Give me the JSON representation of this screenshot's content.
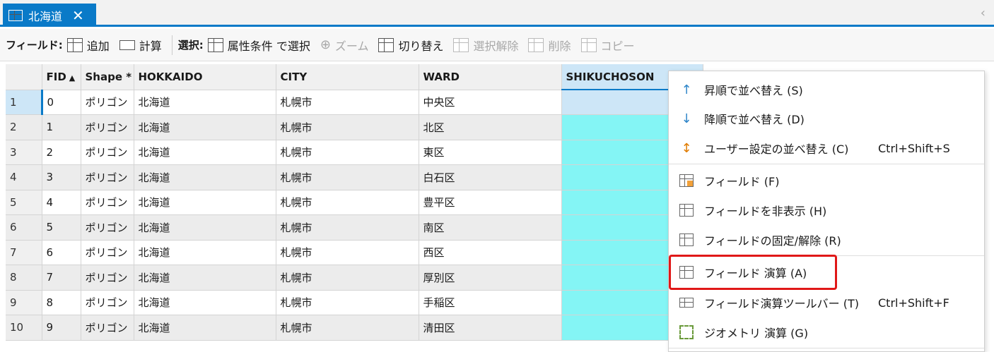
{
  "tab": {
    "title": "北海道",
    "close": "✕"
  },
  "toolbar": {
    "field_label": "フィールド:",
    "add": "追加",
    "calc": "計算",
    "select_label": "選択:",
    "select_by_attr": "属性条件 で選択",
    "zoom": "ズーム",
    "switch": "切り替え",
    "clear": "選択解除",
    "delete": "削除",
    "copy": "コピー"
  },
  "table": {
    "headers": [
      "FID",
      "Shape *",
      "HOKKAIDO",
      "CITY",
      "WARD",
      "SHIKUCHOSON"
    ],
    "rows": [
      {
        "num": "1",
        "fid": "0",
        "shape": "ポリゴン",
        "hokkaido": "北海道",
        "city": "札幌市",
        "ward": "中央区"
      },
      {
        "num": "2",
        "fid": "1",
        "shape": "ポリゴン",
        "hokkaido": "北海道",
        "city": "札幌市",
        "ward": "北区"
      },
      {
        "num": "3",
        "fid": "2",
        "shape": "ポリゴン",
        "hokkaido": "北海道",
        "city": "札幌市",
        "ward": "東区"
      },
      {
        "num": "4",
        "fid": "3",
        "shape": "ポリゴン",
        "hokkaido": "北海道",
        "city": "札幌市",
        "ward": "白石区"
      },
      {
        "num": "5",
        "fid": "4",
        "shape": "ポリゴン",
        "hokkaido": "北海道",
        "city": "札幌市",
        "ward": "豊平区"
      },
      {
        "num": "6",
        "fid": "5",
        "shape": "ポリゴン",
        "hokkaido": "北海道",
        "city": "札幌市",
        "ward": "南区"
      },
      {
        "num": "7",
        "fid": "6",
        "shape": "ポリゴン",
        "hokkaido": "北海道",
        "city": "札幌市",
        "ward": "西区"
      },
      {
        "num": "8",
        "fid": "7",
        "shape": "ポリゴン",
        "hokkaido": "北海道",
        "city": "札幌市",
        "ward": "厚別区"
      },
      {
        "num": "9",
        "fid": "8",
        "shape": "ポリゴン",
        "hokkaido": "北海道",
        "city": "札幌市",
        "ward": "手稲区"
      },
      {
        "num": "10",
        "fid": "9",
        "shape": "ポリゴン",
        "hokkaido": "北海道",
        "city": "札幌市",
        "ward": "清田区"
      }
    ]
  },
  "menu": {
    "sort_asc": "昇順で並べ替え (S)",
    "sort_desc": "降順で並べ替え (D)",
    "custom_sort": "ユーザー設定の並べ替え (C)",
    "custom_sort_sc": "Ctrl+Shift+S",
    "fields": "フィールド (F)",
    "hide_field": "フィールドを非表示 (H)",
    "freeze": "フィールドの固定/解除 (R)",
    "calc_field": "フィールド 演算 (A)",
    "calc_toolbar": "フィールド演算ツールバー (T)",
    "calc_toolbar_sc": "Ctrl+Shift+F",
    "calc_geometry": "ジオメトリ 演算 (G)"
  }
}
